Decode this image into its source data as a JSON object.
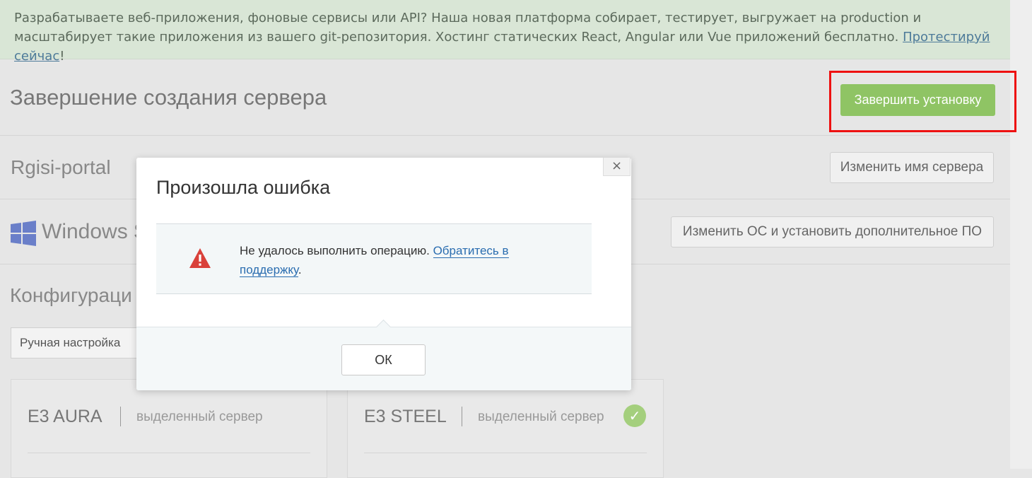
{
  "banner": {
    "text": "Разрабатываете веб-приложения, фоновые сервисы или API? Наша новая платформа собирает, тестирует, выгружает на production и масштабирует такие приложения из вашего git-репозитория. Хостинг статических React, Angular или Vue приложений бесплатно. ",
    "link": "Протестируй сейчас",
    "suffix": "!"
  },
  "header": {
    "title": "Завершение создания сервера",
    "finish_label": "Завершить установку"
  },
  "server": {
    "name": "Rgisi-portal",
    "rename_label": "Изменить имя сервера"
  },
  "os": {
    "name": "Windows S",
    "change_label": "Изменить ОС и установить дополнительное ПО"
  },
  "config": {
    "title": "Конфигураци",
    "tab_label": "Ручная настройка"
  },
  "cards": [
    {
      "name": "E3 AURA",
      "type": "выделенный сервер",
      "selected": false
    },
    {
      "name": "E3 STEEL",
      "type": "выделенный сервер",
      "selected": true
    }
  ],
  "modal": {
    "close_glyph": "×",
    "title": "Произошла ошибка",
    "message_before": "Не удалось выполнить операцию. ",
    "message_link": "Обратитесь в поддержку",
    "message_after": ".",
    "ok_label": "ОК"
  },
  "colors": {
    "accent_green": "#8fc464",
    "highlight_red": "#ee1111",
    "warning_red": "#d9413a",
    "link_blue": "#2a6db0"
  }
}
